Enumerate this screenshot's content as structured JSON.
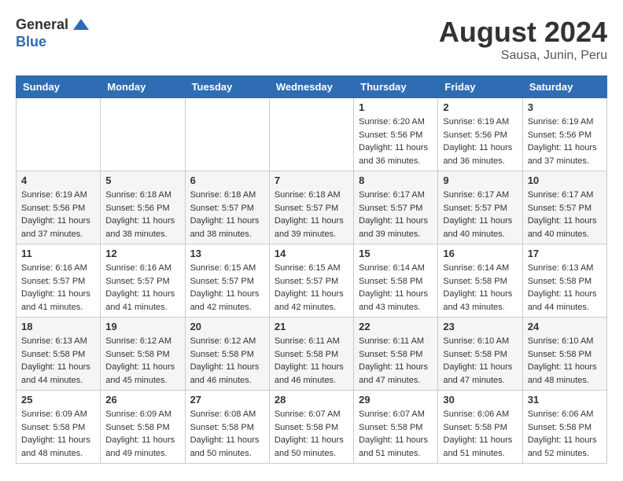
{
  "logo": {
    "general": "General",
    "blue": "Blue"
  },
  "header": {
    "month": "August 2024",
    "location": "Sausa, Junin, Peru"
  },
  "weekdays": [
    "Sunday",
    "Monday",
    "Tuesday",
    "Wednesday",
    "Thursday",
    "Friday",
    "Saturday"
  ],
  "weeks": [
    [
      {
        "day": "",
        "info": ""
      },
      {
        "day": "",
        "info": ""
      },
      {
        "day": "",
        "info": ""
      },
      {
        "day": "",
        "info": ""
      },
      {
        "day": "1",
        "info": "Sunrise: 6:20 AM\nSunset: 5:56 PM\nDaylight: 11 hours\nand 36 minutes."
      },
      {
        "day": "2",
        "info": "Sunrise: 6:19 AM\nSunset: 5:56 PM\nDaylight: 11 hours\nand 36 minutes."
      },
      {
        "day": "3",
        "info": "Sunrise: 6:19 AM\nSunset: 5:56 PM\nDaylight: 11 hours\nand 37 minutes."
      }
    ],
    [
      {
        "day": "4",
        "info": "Sunrise: 6:19 AM\nSunset: 5:56 PM\nDaylight: 11 hours\nand 37 minutes."
      },
      {
        "day": "5",
        "info": "Sunrise: 6:18 AM\nSunset: 5:56 PM\nDaylight: 11 hours\nand 38 minutes."
      },
      {
        "day": "6",
        "info": "Sunrise: 6:18 AM\nSunset: 5:57 PM\nDaylight: 11 hours\nand 38 minutes."
      },
      {
        "day": "7",
        "info": "Sunrise: 6:18 AM\nSunset: 5:57 PM\nDaylight: 11 hours\nand 39 minutes."
      },
      {
        "day": "8",
        "info": "Sunrise: 6:17 AM\nSunset: 5:57 PM\nDaylight: 11 hours\nand 39 minutes."
      },
      {
        "day": "9",
        "info": "Sunrise: 6:17 AM\nSunset: 5:57 PM\nDaylight: 11 hours\nand 40 minutes."
      },
      {
        "day": "10",
        "info": "Sunrise: 6:17 AM\nSunset: 5:57 PM\nDaylight: 11 hours\nand 40 minutes."
      }
    ],
    [
      {
        "day": "11",
        "info": "Sunrise: 6:16 AM\nSunset: 5:57 PM\nDaylight: 11 hours\nand 41 minutes."
      },
      {
        "day": "12",
        "info": "Sunrise: 6:16 AM\nSunset: 5:57 PM\nDaylight: 11 hours\nand 41 minutes."
      },
      {
        "day": "13",
        "info": "Sunrise: 6:15 AM\nSunset: 5:57 PM\nDaylight: 11 hours\nand 42 minutes."
      },
      {
        "day": "14",
        "info": "Sunrise: 6:15 AM\nSunset: 5:57 PM\nDaylight: 11 hours\nand 42 minutes."
      },
      {
        "day": "15",
        "info": "Sunrise: 6:14 AM\nSunset: 5:58 PM\nDaylight: 11 hours\nand 43 minutes."
      },
      {
        "day": "16",
        "info": "Sunrise: 6:14 AM\nSunset: 5:58 PM\nDaylight: 11 hours\nand 43 minutes."
      },
      {
        "day": "17",
        "info": "Sunrise: 6:13 AM\nSunset: 5:58 PM\nDaylight: 11 hours\nand 44 minutes."
      }
    ],
    [
      {
        "day": "18",
        "info": "Sunrise: 6:13 AM\nSunset: 5:58 PM\nDaylight: 11 hours\nand 44 minutes."
      },
      {
        "day": "19",
        "info": "Sunrise: 6:12 AM\nSunset: 5:58 PM\nDaylight: 11 hours\nand 45 minutes."
      },
      {
        "day": "20",
        "info": "Sunrise: 6:12 AM\nSunset: 5:58 PM\nDaylight: 11 hours\nand 46 minutes."
      },
      {
        "day": "21",
        "info": "Sunrise: 6:11 AM\nSunset: 5:58 PM\nDaylight: 11 hours\nand 46 minutes."
      },
      {
        "day": "22",
        "info": "Sunrise: 6:11 AM\nSunset: 5:58 PM\nDaylight: 11 hours\nand 47 minutes."
      },
      {
        "day": "23",
        "info": "Sunrise: 6:10 AM\nSunset: 5:58 PM\nDaylight: 11 hours\nand 47 minutes."
      },
      {
        "day": "24",
        "info": "Sunrise: 6:10 AM\nSunset: 5:58 PM\nDaylight: 11 hours\nand 48 minutes."
      }
    ],
    [
      {
        "day": "25",
        "info": "Sunrise: 6:09 AM\nSunset: 5:58 PM\nDaylight: 11 hours\nand 48 minutes."
      },
      {
        "day": "26",
        "info": "Sunrise: 6:09 AM\nSunset: 5:58 PM\nDaylight: 11 hours\nand 49 minutes."
      },
      {
        "day": "27",
        "info": "Sunrise: 6:08 AM\nSunset: 5:58 PM\nDaylight: 11 hours\nand 50 minutes."
      },
      {
        "day": "28",
        "info": "Sunrise: 6:07 AM\nSunset: 5:58 PM\nDaylight: 11 hours\nand 50 minutes."
      },
      {
        "day": "29",
        "info": "Sunrise: 6:07 AM\nSunset: 5:58 PM\nDaylight: 11 hours\nand 51 minutes."
      },
      {
        "day": "30",
        "info": "Sunrise: 6:06 AM\nSunset: 5:58 PM\nDaylight: 11 hours\nand 51 minutes."
      },
      {
        "day": "31",
        "info": "Sunrise: 6:06 AM\nSunset: 5:58 PM\nDaylight: 11 hours\nand 52 minutes."
      }
    ]
  ]
}
